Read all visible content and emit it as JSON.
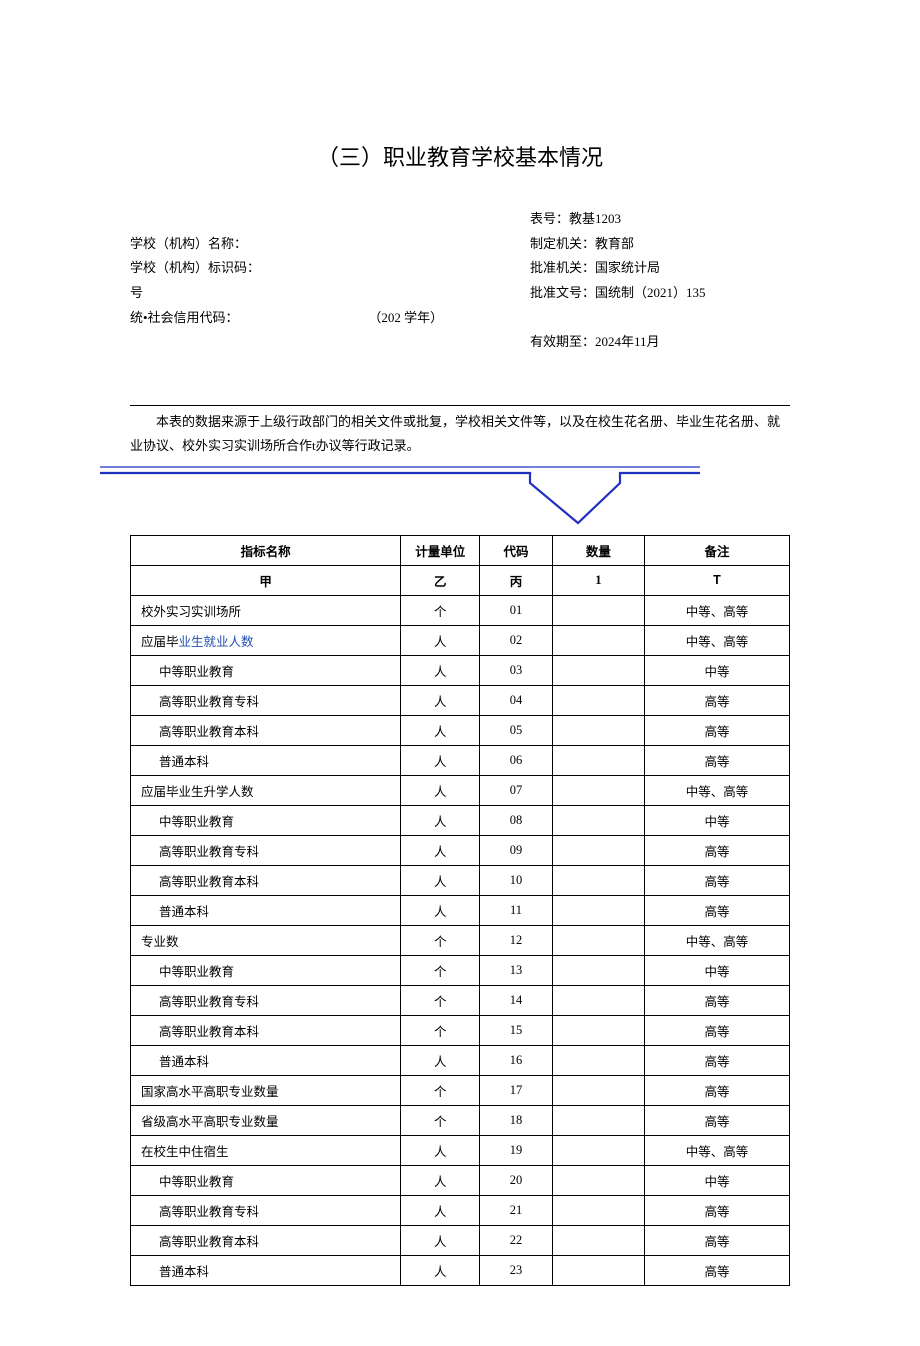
{
  "title": "（三）职业教育学校基本情况",
  "meta": {
    "left": {
      "school_name_label": "学校（机构）名称：",
      "school_code_label": "学校（机构）标识码：",
      "hao": "号",
      "credit_code_label": "统•社会信用代码：",
      "year_label": "（202 学年）"
    },
    "right": {
      "table_no": "表号：教基1203",
      "issuer": "制定机关：教育部",
      "approver": "批准机关：国家统计局",
      "approve_no": "批准文号：国统制（2021）135",
      "valid_until": "有效期至：2024年11月"
    }
  },
  "note": "本表的数据来源于上级行政部门的相关文件或批复，学校相关文件等，以及在校生花名册、毕业生花名册、就业协议、校外实习实训场所合作t办议等行政记录。",
  "headers": {
    "name": "指标名称",
    "unit": "计量单位",
    "code": "代码",
    "qty": "数量",
    "remark": "备注",
    "sub_name": "甲",
    "sub_unit": "乙",
    "sub_code": "丙",
    "sub_qty": "1",
    "sub_remark": "T"
  },
  "rows": [
    {
      "name": "校外实习实训场所",
      "unit": "个",
      "code": "01",
      "qty": "",
      "remark": "中等、高等",
      "indent": false
    },
    {
      "name": "应届毕业生就业人数",
      "unit": "人",
      "code": "02",
      "qty": "",
      "remark": "中等、高等",
      "indent": false,
      "link": "业生就业人数",
      "pre": "应届毕"
    },
    {
      "name": "中等职业教育",
      "unit": "人",
      "code": "03",
      "qty": "",
      "remark": "中等",
      "indent": true
    },
    {
      "name": "高等职业教育专科",
      "unit": "人",
      "code": "04",
      "qty": "",
      "remark": "高等",
      "indent": true
    },
    {
      "name": "高等职业教育本科",
      "unit": "人",
      "code": "05",
      "qty": "",
      "remark": "高等",
      "indent": true
    },
    {
      "name": "普通本科",
      "unit": "人",
      "code": "06",
      "qty": "",
      "remark": "高等",
      "indent": true
    },
    {
      "name": "应届毕业生升学人数",
      "unit": "人",
      "code": "07",
      "qty": "",
      "remark": "中等、高等",
      "indent": false
    },
    {
      "name": "中等职业教育",
      "unit": "人",
      "code": "08",
      "qty": "",
      "remark": "中等",
      "indent": true
    },
    {
      "name": "高等职业教育专科",
      "unit": "人",
      "code": "09",
      "qty": "",
      "remark": "高等",
      "indent": true
    },
    {
      "name": "高等职业教育本科",
      "unit": "人",
      "code": "10",
      "qty": "",
      "remark": "高等",
      "indent": true
    },
    {
      "name": "普通本科",
      "unit": "人",
      "code": "11",
      "qty": "",
      "remark": "高等",
      "indent": true
    },
    {
      "name": "专业数",
      "unit": "个",
      "code": "12",
      "qty": "",
      "remark": "中等、高等",
      "indent": false
    },
    {
      "name": "中等职业教育",
      "unit": "个",
      "code": "13",
      "qty": "",
      "remark": "中等",
      "indent": true
    },
    {
      "name": "高等职业教育专科",
      "unit": "个",
      "code": "14",
      "qty": "",
      "remark": "高等",
      "indent": true
    },
    {
      "name": "高等职业教育本科",
      "unit": "个",
      "code": "15",
      "qty": "",
      "remark": "高等",
      "indent": true
    },
    {
      "name": "普通本科",
      "unit": "人",
      "code": "16",
      "qty": "",
      "remark": "高等",
      "indent": true
    },
    {
      "name": "国家高水平高职专业数量",
      "unit": "个",
      "code": "17",
      "qty": "",
      "remark": "高等",
      "indent": false
    },
    {
      "name": "省级高水平高职专业数量",
      "unit": "个",
      "code": "18",
      "qty": "",
      "remark": "高等",
      "indent": false
    },
    {
      "name": "在校生中住宿生",
      "unit": "人",
      "code": "19",
      "qty": "",
      "remark": "中等、高等",
      "indent": false
    },
    {
      "name": "中等职业教育",
      "unit": "人",
      "code": "20",
      "qty": "",
      "remark": "中等",
      "indent": true
    },
    {
      "name": "高等职业教育专科",
      "unit": "人",
      "code": "21",
      "qty": "",
      "remark": "高等",
      "indent": true
    },
    {
      "name": "高等职业教育本科",
      "unit": "人",
      "code": "22",
      "qty": "",
      "remark": "高等",
      "indent": true
    },
    {
      "name": "普通本科",
      "unit": "人",
      "code": "23",
      "qty": "",
      "remark": "高等",
      "indent": true
    }
  ]
}
